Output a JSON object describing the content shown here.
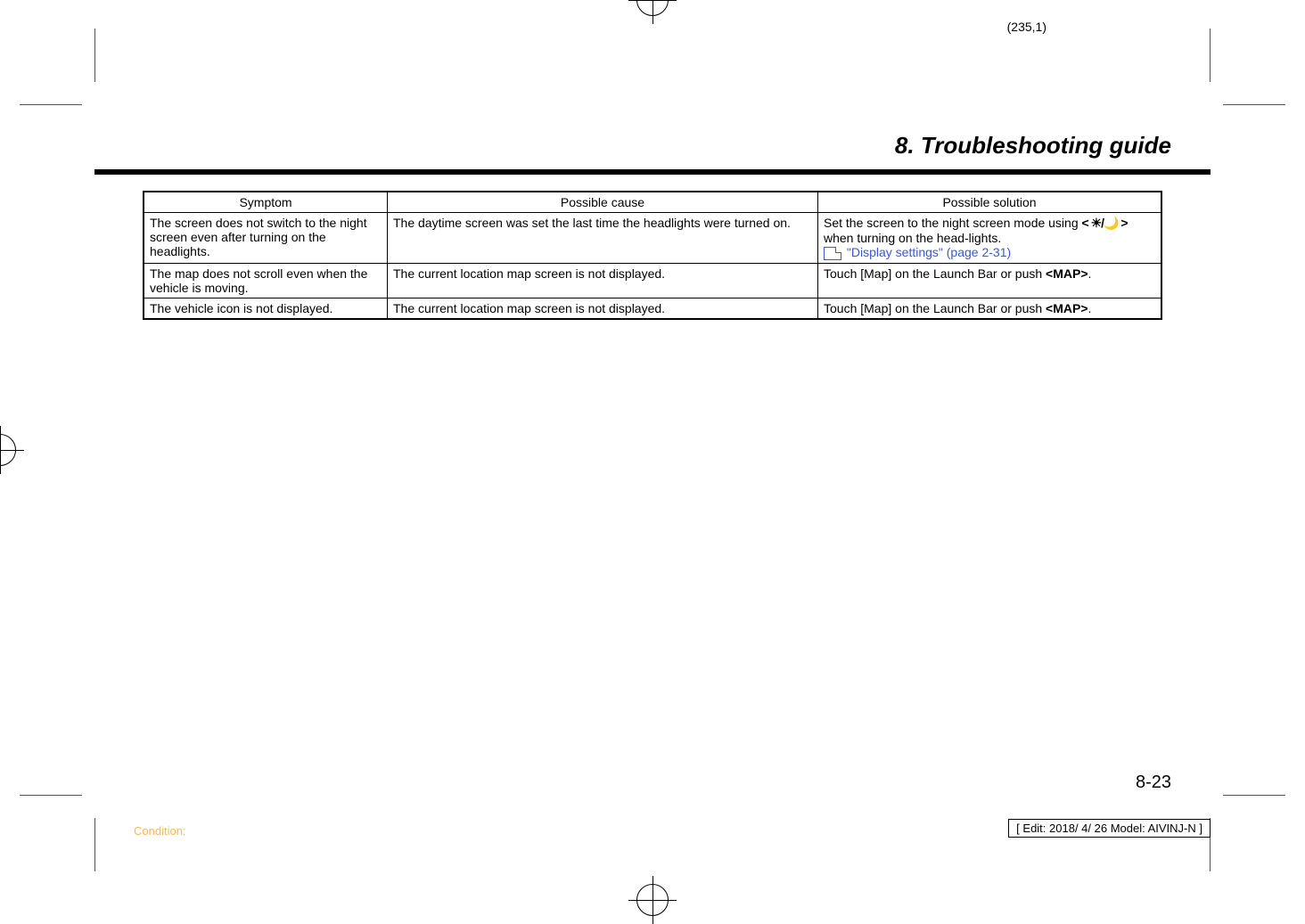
{
  "meta": {
    "page_tuple": "(235,1)",
    "chapter_title": "8. Troubleshooting guide",
    "page_number": "8-23",
    "edit_box": "[ Edit: 2018/ 4/ 26   Model: AIVINJ-N ]",
    "condition_label": "Condition:"
  },
  "table": {
    "headers": [
      "Symptom",
      "Possible cause",
      "Possible solution"
    ],
    "rows": [
      {
        "symptom": "The screen does not switch to the night screen even after turning on the headlights.",
        "cause": "The daytime screen was set the last time the headlights were turned on.",
        "solution_pre": "Set the screen to the night screen mode using ",
        "solution_button": "< ☀/🌙 >",
        "solution_mid": " when turning on the head-lights.",
        "solution_link": "\"Display settings\" (page 2-31)"
      },
      {
        "symptom": "The map does not scroll even when the vehicle is moving.",
        "cause": "The current location map screen is not displayed.",
        "solution_pre": "Touch [Map] on the Launch Bar or push ",
        "solution_button": "<MAP>",
        "solution_mid": ".",
        "solution_link": ""
      },
      {
        "symptom": "The vehicle icon is not displayed.",
        "cause": "The current location map screen is not displayed.",
        "solution_pre": "Touch [Map] on the Launch Bar or push ",
        "solution_button": "<MAP>",
        "solution_mid": ".",
        "solution_link": ""
      }
    ]
  }
}
